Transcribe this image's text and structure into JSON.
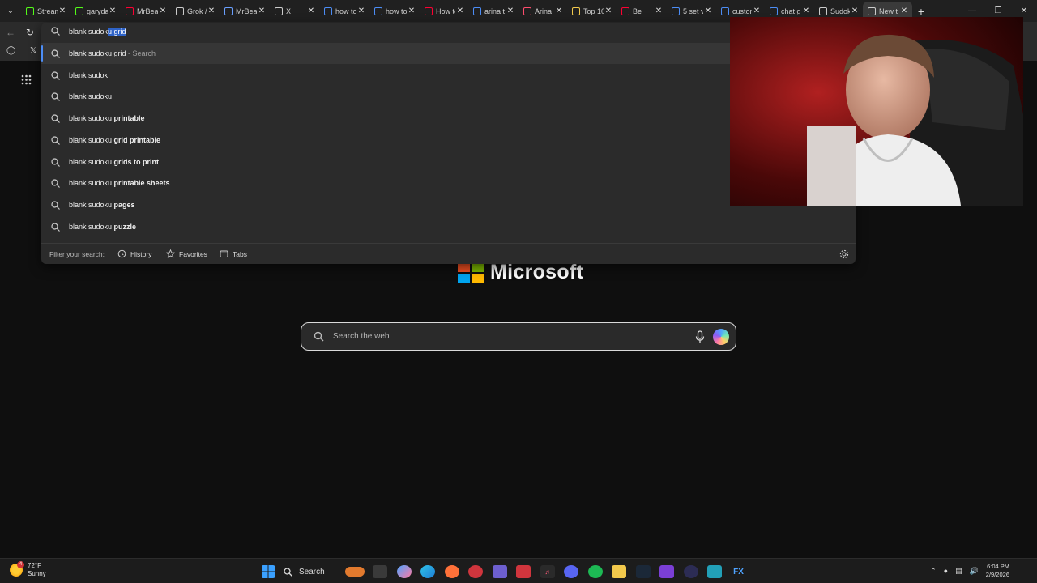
{
  "browser": {
    "tabs": [
      {
        "label": "Stream",
        "favicon": "kick-icon",
        "color": "#53fc18"
      },
      {
        "label": "garyda",
        "favicon": "kick-icon",
        "color": "#53fc18"
      },
      {
        "label": "MrBea",
        "favicon": "youtube-icon",
        "color": "#ff0033"
      },
      {
        "label": "Grok /",
        "favicon": "grok-icon",
        "color": "#cccccc"
      },
      {
        "label": "MrBea",
        "favicon": "reddit-icon",
        "color": "#6aa0ff"
      },
      {
        "label": "X",
        "favicon": "x-icon",
        "color": "#cccccc"
      },
      {
        "label": "how to",
        "favicon": "search-icon",
        "color": "#4c8df6"
      },
      {
        "label": "how to",
        "favicon": "search-icon",
        "color": "#4c8df6"
      },
      {
        "label": "How to",
        "favicon": "youtube-icon",
        "color": "#ff0033"
      },
      {
        "label": "arina t",
        "favicon": "search-icon",
        "color": "#4c8df6"
      },
      {
        "label": "Arina",
        "favicon": "heart-icon",
        "color": "#ff4d6d"
      },
      {
        "label": "Top 10",
        "favicon": "news-icon",
        "color": "#f2c94c"
      },
      {
        "label": "Be",
        "favicon": "youtube-icon",
        "color": "#ff0033"
      },
      {
        "label": "5 set v",
        "favicon": "search-icon",
        "color": "#4c8df6"
      },
      {
        "label": "custon",
        "favicon": "search-icon",
        "color": "#4c8df6"
      },
      {
        "label": "chat g",
        "favicon": "search-icon",
        "color": "#4c8df6"
      },
      {
        "label": "Sudok",
        "favicon": "sudoku-icon",
        "color": "#cccccc"
      },
      {
        "label": "New t",
        "favicon": "newtab-icon",
        "color": "#cccccc"
      }
    ]
  },
  "omnibox": {
    "typed": "blank sudok",
    "autocomplete": "u grid",
    "suggestions": [
      {
        "prefix": "blank sudoku grid",
        "bold": "",
        "suffix": " - Search"
      },
      {
        "prefix": "blank sudok",
        "bold": "",
        "suffix": ""
      },
      {
        "prefix": "blank sudoku",
        "bold": "",
        "suffix": ""
      },
      {
        "prefix": "blank sudoku ",
        "bold": "printable",
        "suffix": ""
      },
      {
        "prefix": "blank sudoku ",
        "bold": "grid printable",
        "suffix": ""
      },
      {
        "prefix": "blank sudoku ",
        "bold": "grids to print",
        "suffix": ""
      },
      {
        "prefix": "blank sudoku ",
        "bold": "printable sheets",
        "suffix": ""
      },
      {
        "prefix": "blank sudoku ",
        "bold": "pages",
        "suffix": ""
      },
      {
        "prefix": "blank sudoku ",
        "bold": "puzzle",
        "suffix": ""
      }
    ],
    "filter_label": "Filter your search:",
    "filters": [
      {
        "label": "History",
        "icon": "history-icon"
      },
      {
        "label": "Favorites",
        "icon": "star-icon"
      },
      {
        "label": "Tabs",
        "icon": "tabs-icon"
      }
    ]
  },
  "page": {
    "brand": "Microsoft",
    "search_placeholder": "Search the web"
  },
  "taskbar": {
    "weather_temp": "72°F",
    "weather_desc": "Sunny",
    "weather_badge": "4",
    "search_label": "Search",
    "time": "6:04 PM",
    "date": "2/9/2026"
  }
}
